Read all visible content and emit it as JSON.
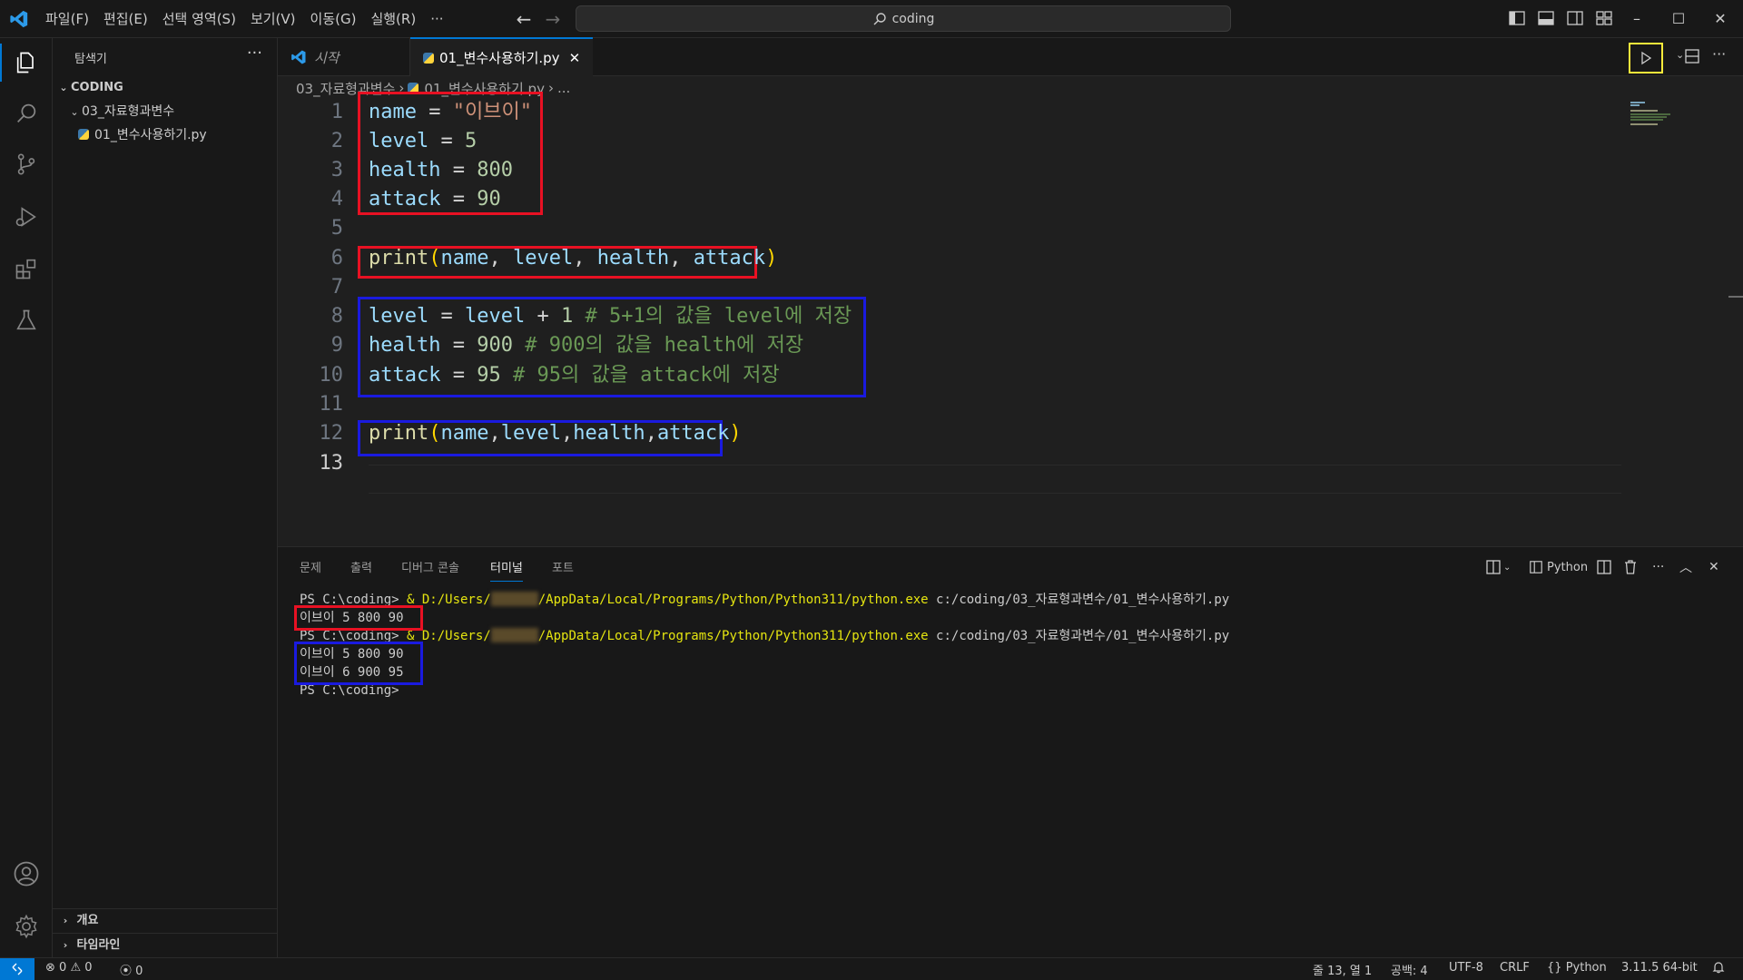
{
  "menu": [
    "파일(F)",
    "편집(E)",
    "선택 영역(S)",
    "보기(V)",
    "이동(G)",
    "실행(R)",
    "···"
  ],
  "search": {
    "text": "coding"
  },
  "sidebar": {
    "title": "탐색기",
    "root": "CODING",
    "folder": "03_자료형과변수",
    "file": "01_변수사용하기.py",
    "sections": [
      "개요",
      "타임라인"
    ]
  },
  "tabs": [
    {
      "label": "시작"
    },
    {
      "label": "01_변수사용하기.py"
    }
  ],
  "breadcrumb": {
    "folder": "03_자료형과변수",
    "file": "01_변수사용하기.py",
    "tail": "..."
  },
  "editor": {
    "line_numbers": [
      "1",
      "2",
      "3",
      "4",
      "5",
      "6",
      "7",
      "8",
      "9",
      "10",
      "11",
      "12",
      "13"
    ],
    "lines": [
      "name = \"이브이\"",
      "level = 5",
      "health = 800",
      "attack = 90",
      "",
      "print(name, level, health, attack)",
      "",
      "level = level + 1 # 5+1의 값을 level에 저장",
      "health = 900 # 900의 값을 health에 저장",
      "attack = 95 # 95의 값을 attack에 저장",
      "",
      "print(name,level,health,attack)",
      ""
    ]
  },
  "panel": {
    "tabs": [
      "문제",
      "출력",
      "디버그 콘솔",
      "터미널",
      "포트"
    ],
    "active_tab": "터미널",
    "shell_label": "Python",
    "terminal": {
      "prompt": "PS C:\\coding>",
      "cmd_prefix": " & D:/Users/",
      "cmd_suffix": "/AppData/Local/Programs/Python/Python311/python.exe",
      "cmd_arg": " c:/coding/03_자료형과변수/01_변수사용하기.py",
      "out1": "이브이 5 800 90",
      "out2a": "이브이 5 800 90",
      "out2b": "이브이 6 900 95"
    }
  },
  "status": {
    "errors": "0",
    "warnings": "0",
    "ports": "0",
    "position": "줄 13, 열 1",
    "spaces": "공백: 4",
    "encoding": "UTF-8",
    "eol": "CRLF",
    "language": "Python",
    "interpreter": "3.11.5 64-bit"
  },
  "colors": {
    "accent": "#0078d4",
    "highlight_red": "#e81123",
    "highlight_blue": "#1a1adf",
    "run_box": "#ffeb3b"
  }
}
